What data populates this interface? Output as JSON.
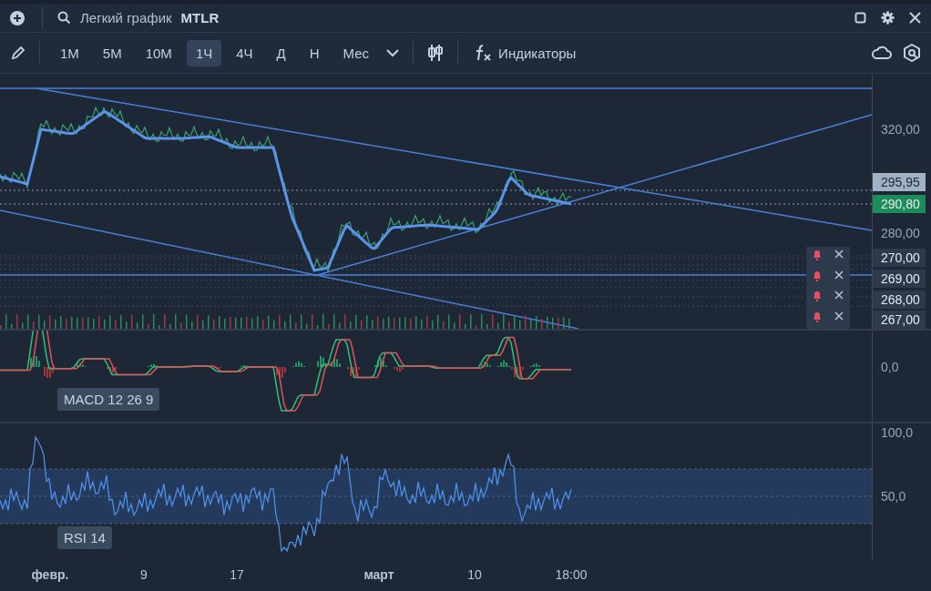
{
  "header": {
    "title": "Легкий график",
    "ticker": "MTLR"
  },
  "toolbar": {
    "intervals": [
      {
        "label": "1M",
        "selected": false
      },
      {
        "label": "5M",
        "selected": false
      },
      {
        "label": "10M",
        "selected": false
      },
      {
        "label": "1Ч",
        "selected": true
      },
      {
        "label": "4Ч",
        "selected": false
      },
      {
        "label": "Д",
        "selected": false
      },
      {
        "label": "Н",
        "selected": false
      },
      {
        "label": "Мес",
        "selected": false
      }
    ],
    "indicators": "Индикаторы"
  },
  "price_axis": [
    {
      "label": "320,00",
      "kind": "plain"
    },
    {
      "label": "295,95",
      "kind": "last"
    },
    {
      "label": "290,80",
      "kind": "current"
    },
    {
      "label": "280,00",
      "kind": "plain"
    },
    {
      "label": "270,00",
      "kind": "alert"
    },
    {
      "label": "269,00",
      "kind": "alert"
    },
    {
      "label": "268,00",
      "kind": "alert"
    },
    {
      "label": "267,00",
      "kind": "alert"
    }
  ],
  "macd": {
    "label": "MACD 12 26 9",
    "axis": [
      "0,0"
    ]
  },
  "rsi": {
    "label": "RSI 14",
    "axis": [
      "100,0",
      "50,0"
    ]
  },
  "time_axis": [
    "февр.",
    "9",
    "17",
    "март",
    "10",
    "18:00"
  ]
}
